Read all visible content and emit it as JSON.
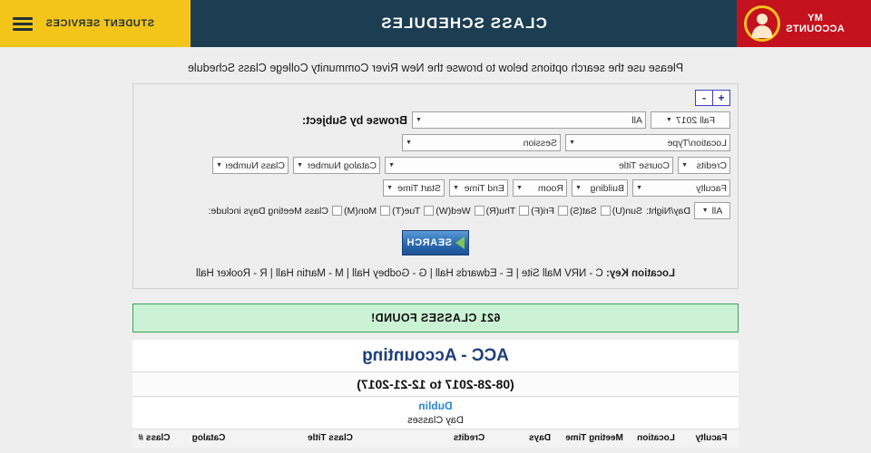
{
  "header": {
    "my_accounts_line1": "MY",
    "my_accounts_line2": "ACCOUNTS",
    "avatar_icon": "user-avatar-icon",
    "title": "CLASS SCHEDULES",
    "student_services": "STUDENT SERVICES",
    "menu_icon": "hamburger-menu-icon"
  },
  "intro": "Please use the search options below to browse the New River Community College Class Schedule",
  "search_panel": {
    "expand_label": "+",
    "collapse_label": "-",
    "browse_by_subject_label": "Browse by Subject:",
    "subject_value": "All",
    "term_value": "Fall 2017",
    "session_label": "Session",
    "location_type_label": "Location/Type",
    "class_number_label": "Class Number",
    "catalog_number_label": "Catalog Number",
    "course_title_label": "Course Title",
    "credits_label": "Credits",
    "start_time_label": "Start Time",
    "end_time_label": "End Time",
    "room_label": "Room",
    "building_label": "Building",
    "faculty_label": "Faculty",
    "meeting_days_label": "Class Meeting Days include:",
    "meeting_days": [
      {
        "label": "Mon(M)",
        "checked": false
      },
      {
        "label": "Tue(T)",
        "checked": false
      },
      {
        "label": "Wed(W)",
        "checked": false
      },
      {
        "label": "Thu(R)",
        "checked": false
      },
      {
        "label": "Fri(F)",
        "checked": false
      },
      {
        "label": "Sat(S)",
        "checked": false
      },
      {
        "label": "Sun(U)",
        "checked": false
      }
    ],
    "day_night_label": "Day/Night:",
    "day_night_value": "All",
    "search_button_label": "SEARCH",
    "location_key_title": "Location Key:",
    "location_key_text": " C - NRV Mall Site | E - Edwards Hall | G - Godbey Hall | M - Martin Hall | R - Rooker Hall"
  },
  "results": {
    "found_banner": "621 CLASSES FOUND!",
    "department_title": "ACC - Accounting",
    "date_range": "(08-28-2017 to 12-21-2017)",
    "campus": "Dublin",
    "day_part": "Day Classes",
    "columns": {
      "class_number": "Class #",
      "catalog": "Catalog",
      "class_title": "Class Title",
      "credits": "Credits",
      "days": "Days",
      "meeting_time": "Meeting Time",
      "location": "Location",
      "faculty": "Faculty"
    }
  },
  "colors": {
    "navy": "#1c3d52",
    "red": "#c3121d",
    "gold": "#f3c41a",
    "dept_blue": "#1d3f7a",
    "campus_blue": "#2d86d4",
    "found_green_bg": "#ccf2d6",
    "found_green_border": "#3aa05a",
    "button_blue": "#2c6bb0",
    "button_arrow_green": "#7fc35a"
  }
}
